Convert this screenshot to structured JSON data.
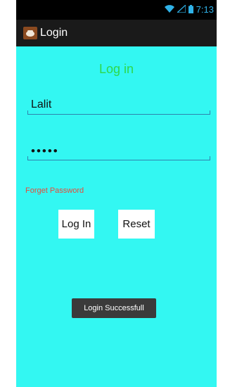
{
  "status_bar": {
    "time": "7:13",
    "icons": [
      "wifi-icon",
      "signal-icon",
      "battery-icon"
    ]
  },
  "action_bar": {
    "app_icon": "android-app-icon",
    "title": "Login"
  },
  "form": {
    "heading": "Log in",
    "username_value": "Lalit",
    "password_value": "•••••",
    "forget_password": "Forget Password",
    "login_button": "Log In",
    "reset_button": "Reset"
  },
  "toast": {
    "message": "Login Successfull"
  },
  "colors": {
    "background": "#33f7f2",
    "heading": "#2ed84a",
    "link": "#e74a3a",
    "status_accent": "#2fb2e8"
  }
}
